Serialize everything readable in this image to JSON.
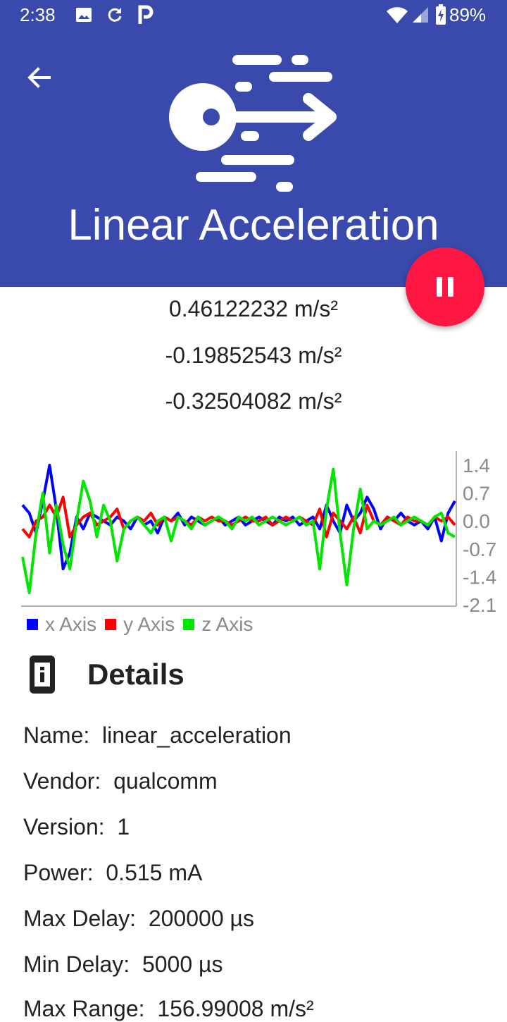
{
  "status_bar": {
    "time": "2:38",
    "battery": "89%"
  },
  "header": {
    "title": "Linear Acceleration",
    "color": "#3a4aac"
  },
  "fab": {
    "icon": "pause-icon",
    "color": "#ff1744"
  },
  "readings": [
    "0.46122232 m/s²",
    "-0.19852543 m/s²",
    "-0.32504082 m/s²"
  ],
  "chart_data": {
    "type": "line",
    "y_ticks": [
      "1.4",
      "0.7",
      "0.0",
      "-0.7",
      "-1.4",
      "-2.1"
    ],
    "ylim": [
      -2.1,
      1.4
    ],
    "legend_position": "bottom-left",
    "grid": false,
    "series": [
      {
        "name": "x Axis",
        "color": "#0000ff",
        "values": [
          0.4,
          0.2,
          -0.3,
          0.5,
          1.4,
          0.3,
          -1.2,
          -0.8,
          0.1,
          -0.2,
          0.2,
          0.1,
          0.0,
          -0.1,
          0.1,
          0.0,
          -0.2,
          0.1,
          -0.1,
          0.0,
          -0.3,
          0.1,
          0.0,
          0.2,
          -0.1,
          0.1,
          0.0,
          -0.1,
          0.0,
          0.1,
          -0.1,
          0.0,
          0.1,
          -0.1,
          0.0,
          0.1,
          0.0,
          -0.1,
          0.1,
          0.0,
          0.1,
          -0.1,
          0.0,
          0.1,
          -0.2,
          0.4,
          0.0,
          -0.3,
          0.4,
          0.0,
          0.2,
          0.6,
          0.3,
          -0.2,
          0.1,
          0.0,
          0.2,
          0.0,
          -0.1,
          0.0,
          -0.2,
          0.1,
          -0.5,
          0.2,
          0.5
        ]
      },
      {
        "name": "y Axis",
        "color": "#ff0000",
        "values": [
          -0.2,
          -0.4,
          0.0,
          0.1,
          0.4,
          0.1,
          0.6,
          -0.4,
          -0.1,
          0.1,
          0.2,
          -0.1,
          0.0,
          0.1,
          0.3,
          -0.2,
          0.0,
          0.1,
          0.0,
          0.2,
          -0.1,
          0.1,
          0.0,
          0.1,
          0.0,
          -0.1,
          0.1,
          0.0,
          0.1,
          0.0,
          0.0,
          -0.1,
          0.0,
          0.1,
          0.0,
          0.0,
          0.1,
          -0.1,
          0.0,
          0.1,
          0.0,
          0.1,
          0.0,
          -0.1,
          0.3,
          -0.4,
          0.2,
          0.0,
          -0.2,
          0.1,
          -0.3,
          0.4,
          0.0,
          -0.1,
          0.1,
          0.0,
          -0.1,
          0.1,
          0.0,
          0.0,
          -0.1,
          0.1,
          0.0,
          0.1,
          -0.1
        ]
      },
      {
        "name": "z Axis",
        "color": "#00e600",
        "values": [
          -0.9,
          -1.8,
          -0.3,
          0.7,
          -0.8,
          0.4,
          -0.6,
          -1.2,
          0.0,
          1.0,
          0.5,
          -0.4,
          0.4,
          0.0,
          -1.0,
          -0.2,
          0.0,
          0.1,
          -0.1,
          -0.3,
          0.0,
          0.1,
          -0.5,
          0.1,
          0.0,
          -0.2,
          0.1,
          -0.1,
          0.0,
          0.1,
          0.0,
          -0.2,
          0.1,
          0.0,
          0.1,
          -0.1,
          0.0,
          0.1,
          0.0,
          -0.1,
          0.0,
          0.1,
          -0.1,
          0.0,
          -1.2,
          0.3,
          1.3,
          -0.3,
          -1.6,
          -0.2,
          0.8,
          -0.2,
          0.0,
          -0.1,
          0.0,
          0.1,
          -0.1,
          0.0,
          0.1,
          0.0,
          -0.1,
          0.1,
          0.2,
          -0.3,
          -0.4
        ]
      }
    ]
  },
  "details": {
    "heading": "Details",
    "rows": [
      "Name:  linear_acceleration",
      "Vendor:  qualcomm",
      "Version:  1",
      "Power:  0.515 mA",
      "Max Delay:  200000 µs",
      "Min Delay:  5000 µs",
      "Max Range:  156.99008 m/s²"
    ]
  }
}
